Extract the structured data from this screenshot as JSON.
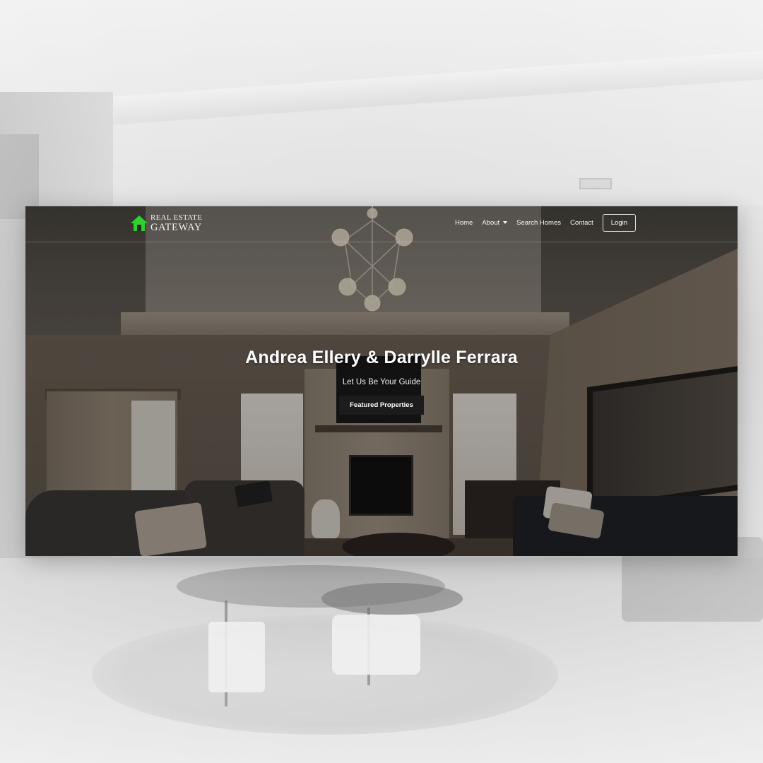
{
  "brand": {
    "line1": "REAL ESTATE",
    "line2": "GATEWAY",
    "accent_color": "#2fd12f"
  },
  "nav": {
    "home": "Home",
    "about": "About",
    "search_homes": "Search Homes",
    "contact": "Contact",
    "login": "Login"
  },
  "hero": {
    "title": "Andrea Ellery & Darrylle Ferrara",
    "subtitle": "Let Us Be Your Guide",
    "button": "Featured Properties"
  },
  "icons": {
    "logo": "house-arrow-logo-icon",
    "about_dropdown": "caret-down-icon"
  }
}
